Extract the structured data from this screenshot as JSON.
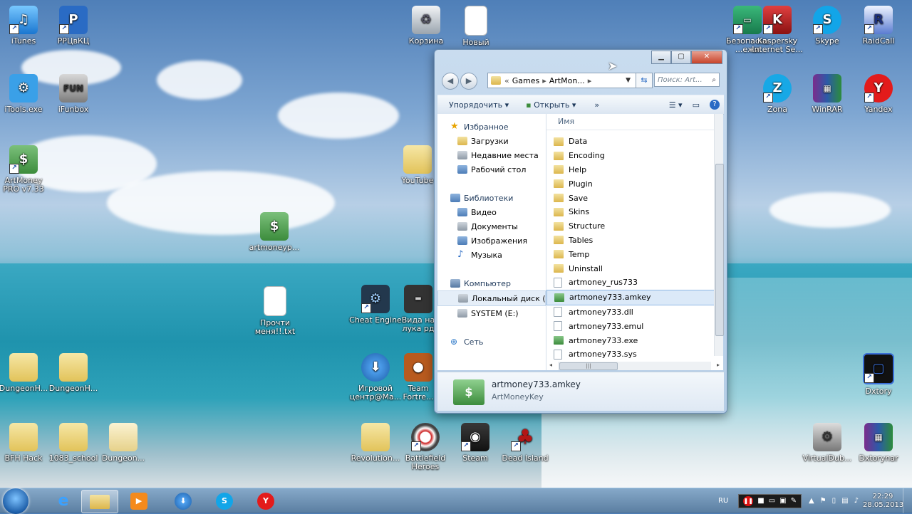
{
  "desktop": {
    "icons": [
      {
        "id": "itunes",
        "label": "iTunes"
      },
      {
        "id": "rrc",
        "label": "РРЦвКЦ"
      },
      {
        "id": "itools",
        "label": "iTools.exe"
      },
      {
        "id": "ifunbox",
        "label": "iFunbox"
      },
      {
        "id": "artmoney-pro",
        "label": "ArtMoney PRO v7.33"
      },
      {
        "id": "artmoney-setup",
        "label": "artmoneyp..."
      },
      {
        "id": "korzina",
        "label": "Корзина"
      },
      {
        "id": "novyi",
        "label": "Новый"
      },
      {
        "id": "youtube",
        "label": "YouTube"
      },
      {
        "id": "prochti",
        "label": "Прочти меня!!.txt"
      },
      {
        "id": "cheat-engine",
        "label": "Cheat Engine"
      },
      {
        "id": "vida",
        "label": "Вида на лука рд"
      },
      {
        "id": "dungeon1",
        "label": "DungeonH..."
      },
      {
        "id": "dungeon2",
        "label": "DungeonH..."
      },
      {
        "id": "igrovoi",
        "label": "Игровой центр@Ma..."
      },
      {
        "id": "team-fortress",
        "label": "Team Fortre..."
      },
      {
        "id": "bfh-hack",
        "label": "BFH Hack"
      },
      {
        "id": "school",
        "label": "1083_school"
      },
      {
        "id": "dungeon3",
        "label": "Dungeon..."
      },
      {
        "id": "revolution",
        "label": "Revolution..."
      },
      {
        "id": "battlefield",
        "label": "Battlefield Heroes"
      },
      {
        "id": "steam",
        "label": "Steam"
      },
      {
        "id": "dead-island",
        "label": "Dead Island"
      },
      {
        "id": "bezopasnye",
        "label": "Безопасные ...ежи"
      },
      {
        "id": "kaspersky",
        "label": "Kaspersky Internet Se..."
      },
      {
        "id": "skype",
        "label": "Skype"
      },
      {
        "id": "raidcall",
        "label": "RaidCall"
      },
      {
        "id": "zona",
        "label": "Zona"
      },
      {
        "id": "winrar",
        "label": "WinRAR"
      },
      {
        "id": "yandex",
        "label": "Yandex"
      },
      {
        "id": "dxtory",
        "label": "Dxtory"
      },
      {
        "id": "virtualdub",
        "label": "VirtualDub..."
      },
      {
        "id": "dxtorynar",
        "label": "Dxtorynar"
      }
    ]
  },
  "explorer": {
    "address": {
      "prefix": "«",
      "crumb1": "Games",
      "crumb2": "ArtMon...",
      "sep": "▸"
    },
    "search_placeholder": "Поиск: Art...",
    "toolbar": {
      "organize": "Упорядочить",
      "open": "Открыть",
      "more": "»"
    },
    "nav": {
      "favorites": {
        "label": "Избранное",
        "items": [
          "Загрузки",
          "Недавние места",
          "Рабочий стол"
        ]
      },
      "libraries": {
        "label": "Библиотеки",
        "items": [
          "Видео",
          "Документы",
          "Изображения",
          "Музыка"
        ]
      },
      "computer": {
        "label": "Компьютер",
        "items": [
          "Локальный диск (C",
          "SYSTEM (E:)"
        ]
      },
      "network": {
        "label": "Сеть"
      }
    },
    "column_name": "Имя",
    "files": [
      {
        "name": "Data",
        "type": "folder"
      },
      {
        "name": "Encoding",
        "type": "folder"
      },
      {
        "name": "Help",
        "type": "folder"
      },
      {
        "name": "Plugin",
        "type": "folder"
      },
      {
        "name": "Save",
        "type": "folder"
      },
      {
        "name": "Skins",
        "type": "folder"
      },
      {
        "name": "Structure",
        "type": "folder"
      },
      {
        "name": "Tables",
        "type": "folder"
      },
      {
        "name": "Temp",
        "type": "folder"
      },
      {
        "name": "Uninstall",
        "type": "folder"
      },
      {
        "name": "artmoney_rus733",
        "type": "file"
      },
      {
        "name": "artmoney733.amkey",
        "type": "money",
        "selected": true
      },
      {
        "name": "artmoney733.dll",
        "type": "file"
      },
      {
        "name": "artmoney733.emul",
        "type": "file"
      },
      {
        "name": "artmoney733.exe",
        "type": "money"
      },
      {
        "name": "artmoney733.sys",
        "type": "file"
      }
    ],
    "details": {
      "filename": "artmoney733.amkey",
      "filetype": "ArtMoneyKey"
    }
  },
  "taskbar": {
    "language": "RU",
    "time": "22:29",
    "date": "28.05.2013"
  }
}
